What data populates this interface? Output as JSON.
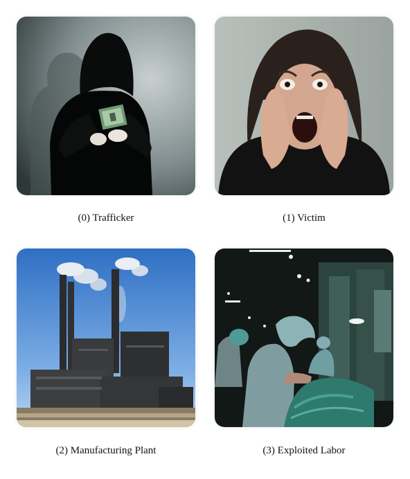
{
  "panels": [
    {
      "index": 0,
      "caption": "(0) Trafficker",
      "image": "hooded-figure-holding-cash"
    },
    {
      "index": 1,
      "caption": "(1) Victim",
      "image": "screaming-woman-hands-on-face"
    },
    {
      "index": 2,
      "caption": "(2) Manufacturing Plant",
      "image": "factory-with-smokestacks"
    },
    {
      "index": 3,
      "caption": "(3) Exploited Labor",
      "image": "workers-at-factory-machines"
    }
  ]
}
